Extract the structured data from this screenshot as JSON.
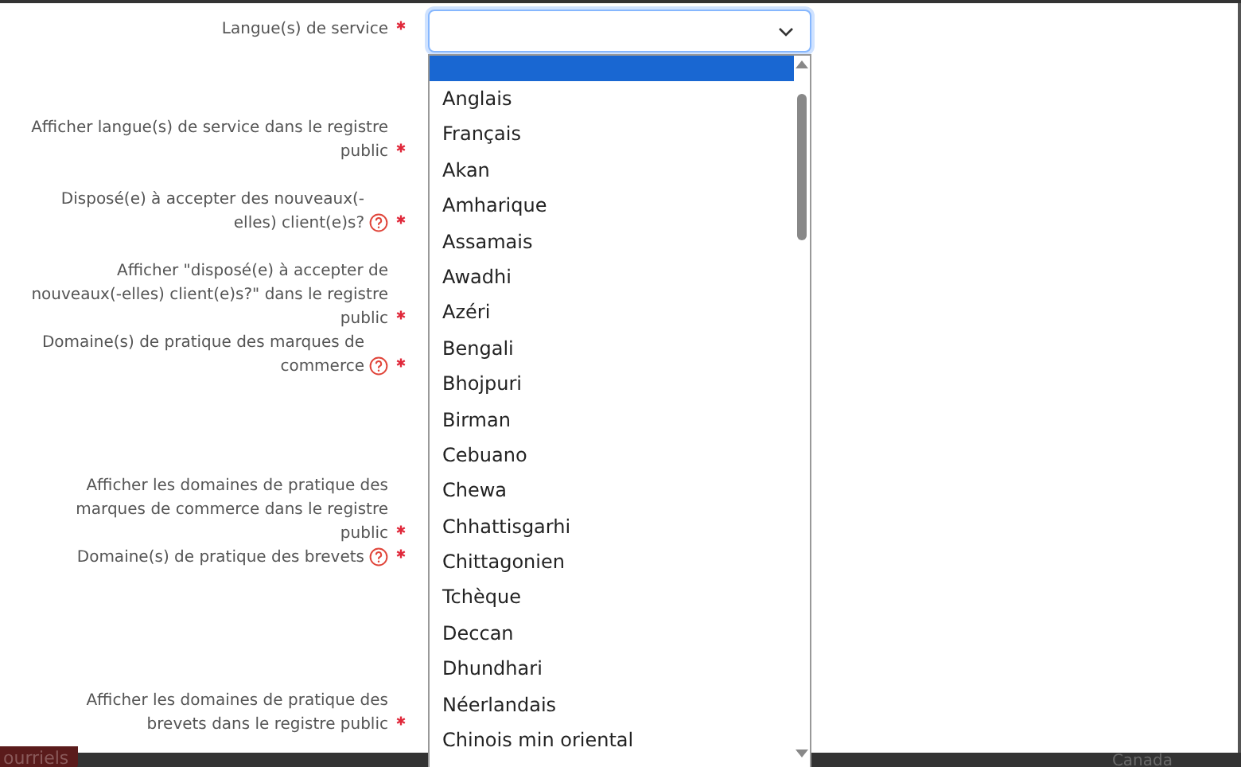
{
  "form": {
    "fields": [
      {
        "label": "Langue(s) de service",
        "required": true,
        "help": false
      },
      {
        "label": "Afficher langue(s) de service dans le registre public",
        "required": true,
        "help": false
      },
      {
        "label": "Disposé(e) à accepter des nouveaux(-elles) client(e)s?",
        "required": true,
        "help": true
      },
      {
        "label": "Afficher \"disposé(e) à accepter de nouveaux(-elles) client(e)s?\" dans le registre public",
        "required": true,
        "help": false
      },
      {
        "label": "Domaine(s) de pratique des marques de commerce",
        "required": true,
        "help": true
      },
      {
        "label": "Afficher les domaines de pratique des marques de commerce dans le registre public",
        "required": true,
        "help": false
      },
      {
        "label": "Domaine(s) de pratique des brevets",
        "required": true,
        "help": true
      },
      {
        "label": "Afficher les domaines de pratique des brevets dans le registre public",
        "required": true,
        "help": false
      }
    ]
  },
  "dropdown": {
    "expanded": true,
    "empty_option": {
      "selected": true
    },
    "options": [
      {
        "label": "Anglais",
        "selected": false
      },
      {
        "label": "Français",
        "selected": false
      },
      {
        "label": "Akan",
        "selected": false
      },
      {
        "label": "Amharique",
        "selected": false
      },
      {
        "label": "Assamais",
        "selected": false
      },
      {
        "label": "Awadhi",
        "selected": false
      },
      {
        "label": "Azéri",
        "selected": false
      },
      {
        "label": "Bengali",
        "selected": false
      },
      {
        "label": "Bhojpuri",
        "selected": false
      },
      {
        "label": "Birman",
        "selected": false
      },
      {
        "label": "Cebuano",
        "selected": false
      },
      {
        "label": "Chewa",
        "selected": false
      },
      {
        "label": "Chhattisgarhi",
        "selected": false
      },
      {
        "label": "Chittagonien",
        "selected": false
      },
      {
        "label": "Tchèque",
        "selected": false
      },
      {
        "label": "Deccan",
        "selected": false
      },
      {
        "label": "Dhundhari",
        "selected": false
      },
      {
        "label": "Néerlandais",
        "selected": false
      },
      {
        "label": "Chinois min oriental",
        "selected": false
      }
    ]
  },
  "footer": {
    "button": "ourriels",
    "country": "Canada"
  }
}
